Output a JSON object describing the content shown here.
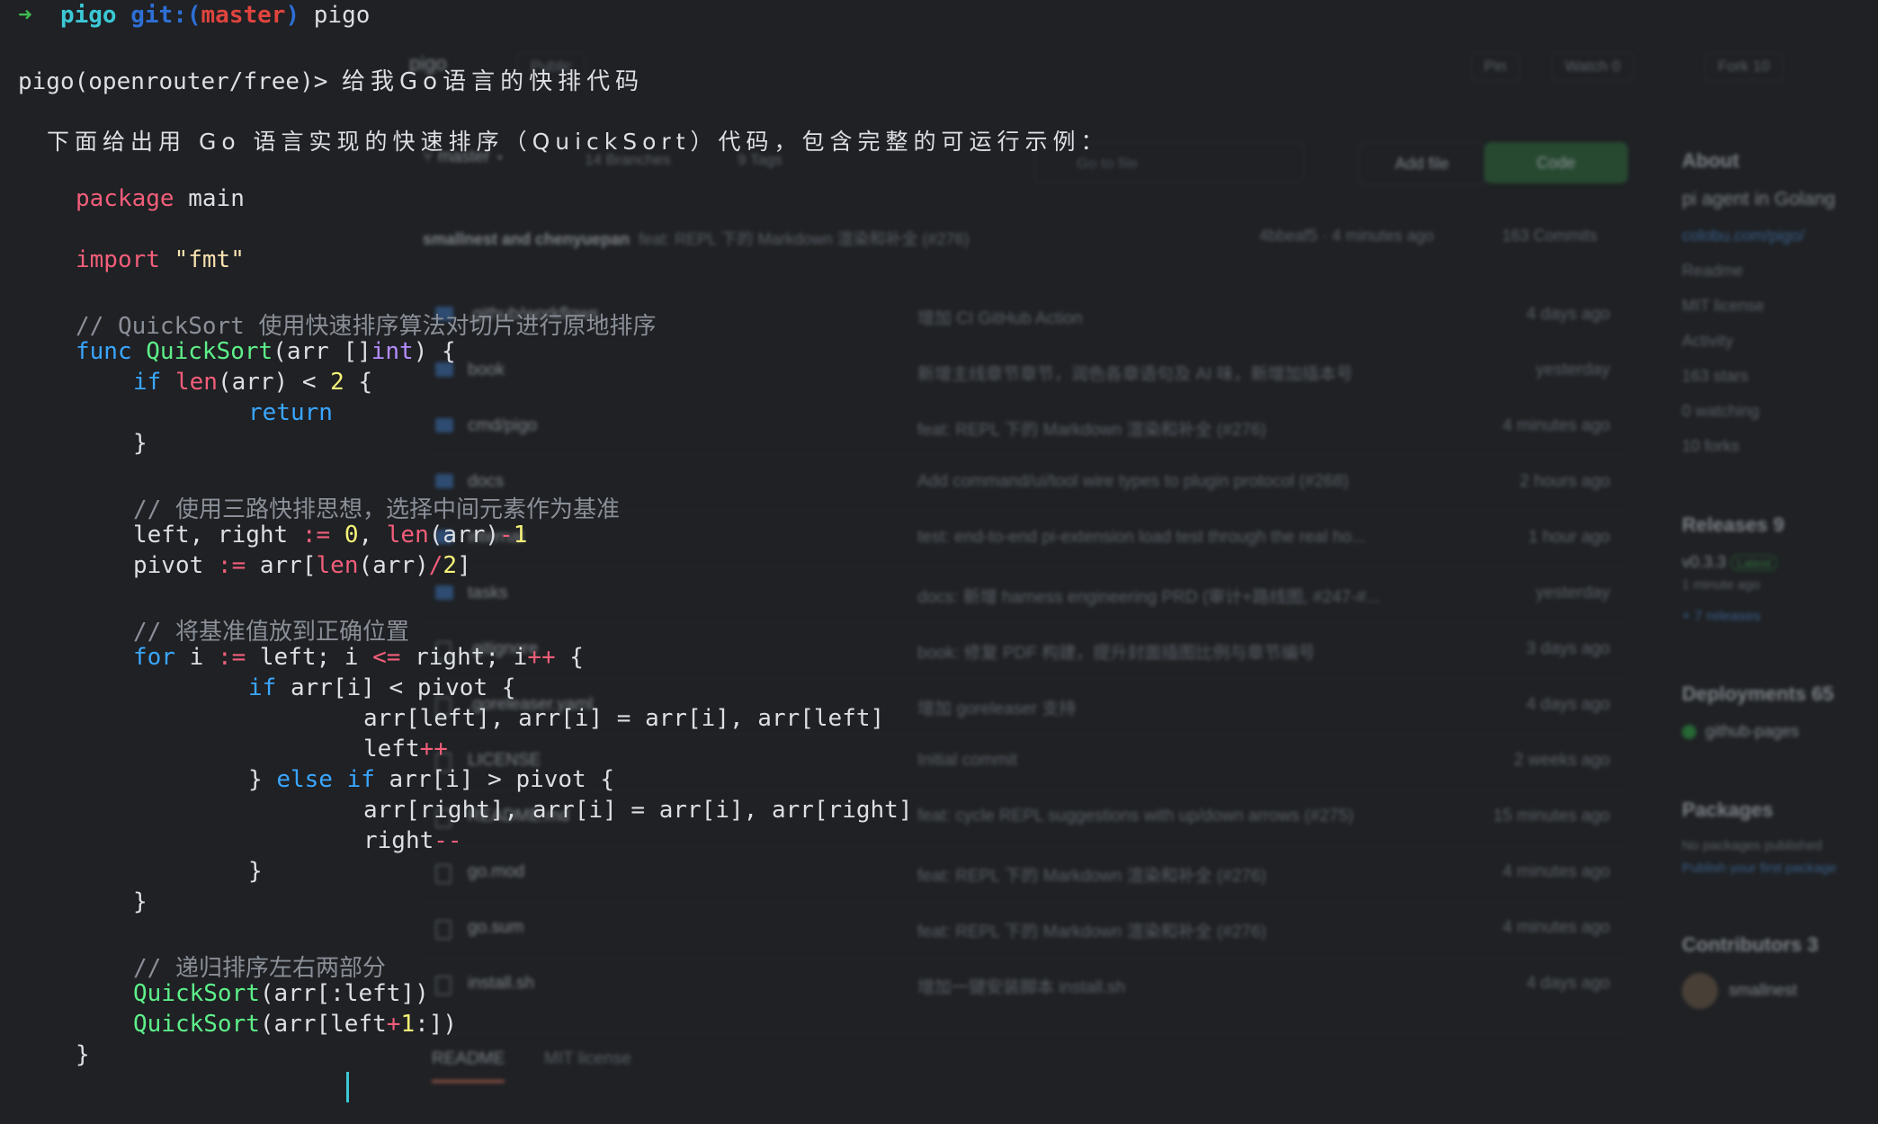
{
  "github": {
    "owner": "pigo",
    "visibility": "Public",
    "pin_label": "Pin",
    "watch_label": "Watch",
    "watch_count": "0",
    "fork_label": "Fork",
    "fork_count": "10",
    "branch": "master",
    "branches": "14 Branches",
    "tags": "9 Tags",
    "search_placeholder": "Go to file",
    "add_file": "Add file",
    "code_button": "Code",
    "commit": {
      "authors": "smallnest and chenyuepan",
      "message": "feat: REPL 下的 Markdown 渲染和补全 (#276)",
      "hash": "4bbeaf5 · 4 minutes ago",
      "count": "163 Commits"
    },
    "files": [
      {
        "name": ".github/workflows",
        "type": "dir",
        "msg": "增加 CI GitHub Action",
        "time": "4 days ago"
      },
      {
        "name": "book",
        "type": "dir",
        "msg": "新增主线章节章节，润色各章语句及 AI 味，新增加插本号",
        "time": "yesterday"
      },
      {
        "name": "cmd/pigo",
        "type": "dir",
        "msg": "feat: REPL 下的 Markdown 渲染和补全 (#276)",
        "time": "4 minutes ago"
      },
      {
        "name": "docs",
        "type": "dir",
        "msg": "Add command/ui/tool wire types to plugin protocol (#268)",
        "time": "2 hours ago"
      },
      {
        "name": "internal",
        "type": "dir",
        "msg": "test: end-to-end pi-extension load test through the real ho...",
        "time": "1 hour ago"
      },
      {
        "name": "tasks",
        "type": "dir",
        "msg": "docs: 新增 harness engineering PRD (审计+路线图, #247-#...",
        "time": "yesterday"
      },
      {
        "name": ".gitignore",
        "type": "file",
        "msg": "book: 修复 PDF 构建，提升封面插图比例与章节编号",
        "time": "3 days ago"
      },
      {
        "name": ".goreleaser.yaml",
        "type": "file",
        "msg": "增加 goreleaser 支持",
        "time": "4 days ago"
      },
      {
        "name": "LICENSE",
        "type": "file",
        "msg": "Initial commit",
        "time": "2 weeks ago"
      },
      {
        "name": "README.md",
        "type": "file",
        "msg": "feat: cycle REPL suggestions with up/down arrows (#275)",
        "time": "15 minutes ago"
      },
      {
        "name": "go.mod",
        "type": "file",
        "msg": "feat: REPL 下的 Markdown 渲染和补全 (#276)",
        "time": "4 minutes ago"
      },
      {
        "name": "go.sum",
        "type": "file",
        "msg": "feat: REPL 下的 Markdown 渲染和补全 (#276)",
        "time": "4 minutes ago"
      },
      {
        "name": "install.sh",
        "type": "file",
        "msg": "增加一键安装脚本 install.sh",
        "time": "4 days ago"
      }
    ],
    "readme_tab": "README",
    "license_tab": "MIT license",
    "sidebar": {
      "about_title": "About",
      "description": "pi agent in Golang",
      "link": "colobu.com/pigo/",
      "readme": "Readme",
      "license": "MIT license",
      "activity": "Activity",
      "stars": "163 stars",
      "watching": "0 watching",
      "forks": "10 forks",
      "releases_title": "Releases 9",
      "release_tag": "v0.3.3",
      "release_latest": "Latest",
      "release_time": "1 minute ago",
      "more_releases": "+ 7 releases",
      "deployments_title": "Deployments 65",
      "deployment": "github-pages",
      "packages_title": "Packages",
      "packages_empty": "No packages published",
      "packages_link": "Publish your first package",
      "contributors_title": "Contributors 3",
      "contributor": "smallnest"
    }
  },
  "terminal": {
    "prompt_arrow": "➜",
    "prompt_dir": "pigo",
    "prompt_git": "git:(",
    "prompt_branch": "master",
    "prompt_git_close": ")",
    "prompt_command": "pigo",
    "repl_prompt": "pigo(openrouter/free)> ",
    "user_query": "给我Go语言的快排代码",
    "response_intro": "下面给出用 Go 语言实现的快速排序（QuickSort）代码，包含完整的可运行示例：",
    "code": {
      "l1_kw": "package",
      "l1_rest": " main",
      "l2_kw": "import",
      "l2_str": "\"fmt\"",
      "c1": "// QuickSort 使用快速排序算法对切片进行原地排序",
      "func_kw": "func",
      "func_name": "QuickSort",
      "func_params_open": "(arr []",
      "func_type": "int",
      "func_params_close": ") {",
      "if_kw": "if",
      "len_fn": "len",
      "if_rest_a": "(arr) < ",
      "if_num": "2",
      "if_rest_b": " {",
      "return_kw": "return",
      "close_brace": "}",
      "c2": "// 使用三路快排思想，选择中间元素作为基准",
      "lr_a": "left, right ",
      "assign_op": ":=",
      "lr_num0": "0",
      "lr_b": ", ",
      "lr_len": "len",
      "lr_c": "(arr)",
      "minus": "-",
      "one": "1",
      "pivot_a": "pivot ",
      "pivot_b": " arr[",
      "pivot_len": "len",
      "pivot_c": "(arr)",
      "slash": "/",
      "two": "2",
      "pivot_d": "]",
      "c3": "// 将基准值放到正确位置",
      "for_kw": "for",
      "for_a": " i ",
      "for_b": " left; i ",
      "le_op": "<=",
      "for_c": " right; i",
      "inc_op": "++",
      "for_d": " {",
      "if2_a": " arr[i] < pivot {",
      "swap1": "arr[left], arr[i] = arr[i], arr[left]",
      "left_var": "left",
      "else_kw": "} ",
      "else_word": "else",
      "else_if": " if",
      "else_rest": " arr[i] > pivot {",
      "swap2": "arr[right], arr[i] = arr[i], arr[right]",
      "right_var": "right",
      "dec_op": "--",
      "c4": "// 递归排序左右两部分",
      "rec1_fn": "QuickSort",
      "rec1_arg": "(arr[:left])",
      "rec2_fn": "QuickSort",
      "rec2_a": "(arr[left",
      "plus": "+",
      "rec2_num": "1",
      "rec2_b": ":])"
    }
  }
}
